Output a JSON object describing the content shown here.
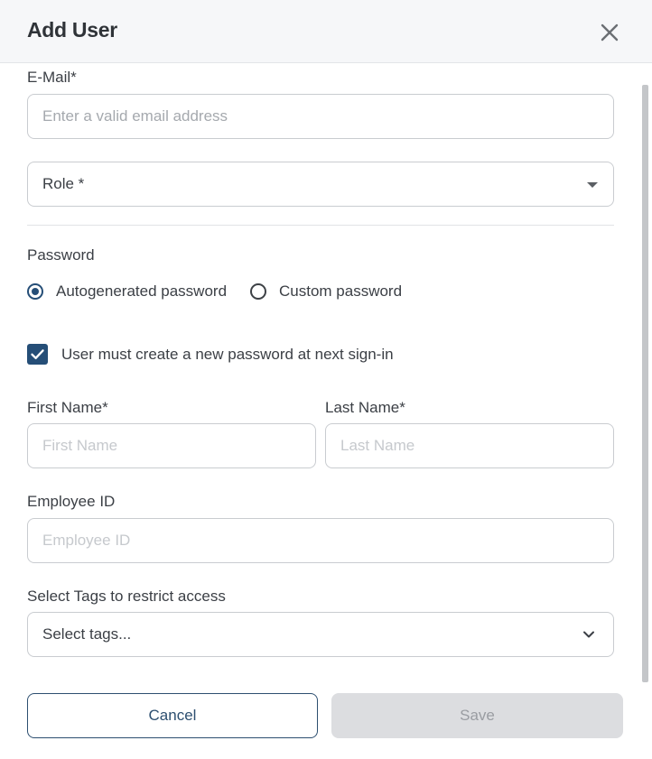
{
  "dialog": {
    "title": "Add User",
    "close_icon": "close-icon"
  },
  "form": {
    "email": {
      "label": "E-Mail*",
      "value": "",
      "placeholder": "Enter a valid email address"
    },
    "role": {
      "placeholder": "Role *",
      "icon": "caret-down-icon"
    },
    "password": {
      "label": "Password",
      "options": [
        {
          "label": "Autogenerated password",
          "checked": true
        },
        {
          "label": "Custom password",
          "checked": false
        }
      ]
    },
    "force_reset": {
      "label": "User must create a new password at next sign-in",
      "checked": true
    },
    "first_name": {
      "label": "First Name*",
      "value": "",
      "placeholder": "First Name"
    },
    "last_name": {
      "label": "Last Name*",
      "value": "",
      "placeholder": "Last Name"
    },
    "employee_id": {
      "label": "Employee ID",
      "value": "",
      "placeholder": "Employee ID"
    },
    "tags": {
      "label": "Select Tags to restrict access",
      "placeholder": "Select tags...",
      "icon": "chevron-down-icon"
    }
  },
  "actions": {
    "cancel_label": "Cancel",
    "save_label": "Save"
  },
  "colors": {
    "accent": "#254e77",
    "header_bg": "#f6f7f9",
    "disabled_bg": "#dcdde0"
  }
}
